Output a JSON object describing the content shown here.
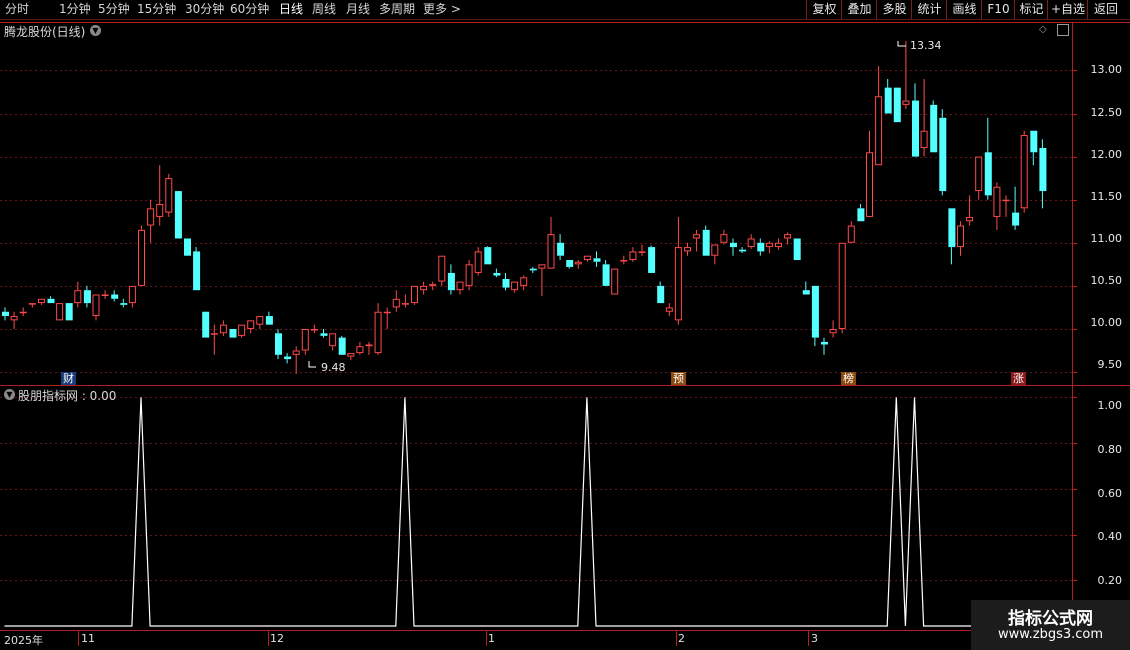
{
  "toolbar": {
    "periods": [
      "分时",
      "1分钟",
      "5分钟",
      "15分钟",
      "30分钟",
      "60分钟",
      "日线",
      "周线",
      "月线",
      "多周期",
      "更多 >"
    ],
    "active_period": "日线",
    "buttons": [
      "复权",
      "叠加",
      "多股",
      "统计",
      "画线",
      "F10",
      "标记",
      "+自选",
      "返回"
    ]
  },
  "main_pane": {
    "title": "腾龙股份(日线)",
    "y_ticks": [
      "13.00",
      "12.50",
      "12.00",
      "11.50",
      "11.00",
      "10.50",
      "10.00",
      "9.50"
    ],
    "high_label": "13.34",
    "low_label": "9.48",
    "tags": [
      "财",
      "预",
      "榜",
      "涨"
    ]
  },
  "indicator_pane": {
    "title": "股朋指标网 : 0.00",
    "y_ticks": [
      "1.00",
      "0.80",
      "0.60",
      "0.40",
      "0.20"
    ]
  },
  "x_axis": {
    "labels": [
      "2025年",
      "11",
      "12",
      "1",
      "2",
      "3"
    ]
  },
  "colors": {
    "up": "#ff4a4a",
    "down": "#54ffff",
    "frame": "#b41e1e",
    "signal": "#ffffff"
  },
  "chart_data": {
    "type": "candlestick",
    "ylim": [
      9.35,
      13.55
    ],
    "y_ticks": [
      13.0,
      12.5,
      12.0,
      11.5,
      11.0,
      10.5,
      10.0,
      9.5
    ],
    "high": 13.34,
    "low": 9.48,
    "ohlc": [
      [
        10.2,
        10.25,
        10.1,
        10.15
      ],
      [
        10.1,
        10.2,
        10.0,
        10.15
      ],
      [
        10.2,
        10.25,
        10.15,
        10.2
      ],
      [
        10.3,
        10.3,
        10.25,
        10.3
      ],
      [
        10.3,
        10.35,
        10.28,
        10.35
      ],
      [
        10.35,
        10.38,
        10.3,
        10.3
      ],
      [
        10.1,
        10.3,
        10.1,
        10.3
      ],
      [
        10.3,
        10.3,
        10.1,
        10.1
      ],
      [
        10.3,
        10.55,
        10.25,
        10.45
      ],
      [
        10.45,
        10.5,
        10.25,
        10.3
      ],
      [
        10.15,
        10.4,
        10.1,
        10.4
      ],
      [
        10.4,
        10.45,
        10.35,
        10.4
      ],
      [
        10.4,
        10.45,
        10.32,
        10.35
      ],
      [
        10.3,
        10.35,
        10.25,
        10.28
      ],
      [
        10.3,
        10.5,
        10.25,
        10.5
      ],
      [
        10.5,
        11.2,
        10.5,
        11.15
      ],
      [
        11.2,
        11.5,
        11.0,
        11.4
      ],
      [
        11.3,
        11.9,
        11.2,
        11.45
      ],
      [
        11.35,
        11.8,
        11.3,
        11.75
      ],
      [
        11.6,
        11.6,
        11.05,
        11.05
      ],
      [
        11.05,
        11.05,
        10.85,
        10.85
      ],
      [
        10.9,
        10.95,
        10.45,
        10.45
      ],
      [
        10.2,
        10.2,
        9.9,
        9.9
      ],
      [
        9.95,
        10.05,
        9.7,
        9.95
      ],
      [
        9.95,
        10.1,
        9.92,
        10.05
      ],
      [
        10.0,
        10.0,
        9.9,
        9.9
      ],
      [
        9.92,
        10.05,
        9.9,
        10.05
      ],
      [
        10.0,
        10.1,
        9.95,
        10.1
      ],
      [
        10.05,
        10.15,
        10.0,
        10.15
      ],
      [
        10.15,
        10.2,
        10.05,
        10.05
      ],
      [
        9.95,
        10.0,
        9.65,
        9.7
      ],
      [
        9.68,
        9.72,
        9.6,
        9.65
      ],
      [
        9.7,
        9.8,
        9.48,
        9.75
      ],
      [
        9.75,
        10.0,
        9.7,
        10.0
      ],
      [
        10.0,
        10.05,
        9.95,
        10.0
      ],
      [
        9.95,
        10.0,
        9.9,
        9.92
      ],
      [
        9.8,
        9.95,
        9.75,
        9.95
      ],
      [
        9.9,
        9.92,
        9.7,
        9.7
      ],
      [
        9.68,
        9.72,
        9.64,
        9.72
      ],
      [
        9.72,
        9.85,
        9.7,
        9.8
      ],
      [
        9.8,
        9.85,
        9.7,
        9.82
      ],
      [
        9.72,
        10.3,
        9.7,
        10.2
      ],
      [
        10.2,
        10.25,
        10.0,
        10.2
      ],
      [
        10.25,
        10.45,
        10.2,
        10.35
      ],
      [
        10.3,
        10.4,
        10.25,
        10.3
      ],
      [
        10.3,
        10.5,
        10.28,
        10.5
      ],
      [
        10.45,
        10.55,
        10.4,
        10.5
      ],
      [
        10.5,
        10.55,
        10.45,
        10.52
      ],
      [
        10.55,
        10.85,
        10.5,
        10.85
      ],
      [
        10.65,
        10.75,
        10.4,
        10.45
      ],
      [
        10.45,
        10.55,
        10.4,
        10.55
      ],
      [
        10.5,
        10.8,
        10.45,
        10.75
      ],
      [
        10.65,
        10.95,
        10.62,
        10.9
      ],
      [
        10.95,
        10.96,
        10.75,
        10.75
      ],
      [
        10.65,
        10.7,
        10.6,
        10.62
      ],
      [
        10.58,
        10.65,
        10.45,
        10.48
      ],
      [
        10.45,
        10.55,
        10.42,
        10.55
      ],
      [
        10.5,
        10.62,
        10.45,
        10.6
      ],
      [
        10.7,
        10.72,
        10.65,
        10.68
      ],
      [
        10.7,
        10.75,
        10.38,
        10.75
      ],
      [
        10.7,
        11.3,
        10.7,
        11.1
      ],
      [
        11.0,
        11.1,
        10.8,
        10.85
      ],
      [
        10.8,
        10.8,
        10.7,
        10.72
      ],
      [
        10.75,
        10.8,
        10.7,
        10.78
      ],
      [
        10.8,
        10.85,
        10.78,
        10.85
      ],
      [
        10.82,
        10.9,
        10.72,
        10.78
      ],
      [
        10.75,
        10.8,
        10.5,
        10.5
      ],
      [
        10.4,
        10.7,
        10.4,
        10.7
      ],
      [
        10.8,
        10.85,
        10.75,
        10.8
      ],
      [
        10.8,
        10.95,
        10.78,
        10.9
      ],
      [
        10.9,
        10.98,
        10.85,
        10.9
      ],
      [
        10.95,
        10.97,
        10.65,
        10.65
      ],
      [
        10.5,
        10.55,
        10.3,
        10.3
      ],
      [
        10.2,
        10.3,
        10.15,
        10.25
      ],
      [
        10.1,
        11.3,
        10.05,
        10.95
      ],
      [
        10.9,
        11.0,
        10.85,
        10.95
      ],
      [
        11.05,
        11.15,
        10.9,
        11.1
      ],
      [
        11.15,
        11.2,
        10.85,
        10.85
      ],
      [
        10.85,
        10.98,
        10.75,
        10.98
      ],
      [
        11.0,
        11.15,
        10.98,
        11.1
      ],
      [
        11.0,
        11.05,
        10.85,
        10.95
      ],
      [
        10.92,
        10.95,
        10.88,
        10.9
      ],
      [
        10.95,
        11.1,
        10.93,
        11.05
      ],
      [
        11.0,
        11.05,
        10.85,
        10.9
      ],
      [
        10.95,
        11.02,
        10.88,
        11.0
      ],
      [
        10.95,
        11.05,
        10.92,
        11.0
      ],
      [
        11.05,
        11.12,
        10.98,
        11.1
      ],
      [
        11.05,
        11.05,
        10.8,
        10.8
      ],
      [
        10.45,
        10.55,
        10.4,
        10.4
      ],
      [
        10.5,
        10.5,
        9.8,
        9.9
      ],
      [
        9.85,
        9.9,
        9.7,
        9.82
      ],
      [
        9.95,
        10.1,
        9.9,
        10.0
      ],
      [
        10.0,
        11.0,
        9.95,
        11.0
      ],
      [
        11.0,
        11.25,
        11.0,
        11.2
      ],
      [
        11.4,
        11.45,
        11.25,
        11.25
      ],
      [
        11.3,
        12.3,
        11.3,
        12.05
      ],
      [
        11.9,
        13.05,
        11.9,
        12.7
      ],
      [
        12.8,
        12.9,
        12.5,
        12.5
      ],
      [
        12.8,
        12.8,
        12.4,
        12.4
      ],
      [
        12.6,
        13.34,
        12.55,
        12.65
      ],
      [
        12.65,
        12.85,
        12.0,
        12.0
      ],
      [
        12.1,
        12.9,
        12.0,
        12.3
      ],
      [
        12.6,
        12.65,
        12.05,
        12.05
      ],
      [
        12.45,
        12.55,
        11.55,
        11.6
      ],
      [
        11.4,
        11.4,
        10.75,
        10.95
      ],
      [
        10.95,
        11.25,
        10.85,
        11.2
      ],
      [
        11.25,
        11.55,
        11.2,
        11.3
      ],
      [
        11.6,
        12.0,
        11.5,
        12.0
      ],
      [
        12.05,
        12.45,
        11.5,
        11.55
      ],
      [
        11.3,
        11.7,
        11.15,
        11.65
      ],
      [
        11.5,
        11.55,
        11.3,
        11.5
      ],
      [
        11.35,
        11.65,
        11.15,
        11.2
      ],
      [
        11.4,
        12.3,
        11.35,
        12.25
      ],
      [
        12.3,
        12.3,
        11.9,
        12.05
      ],
      [
        12.1,
        12.2,
        11.4,
        11.6
      ]
    ],
    "indicator": {
      "ylim": [
        0,
        1.05
      ],
      "y_ticks": [
        1.0,
        0.8,
        0.6,
        0.4,
        0.2
      ],
      "signal_bars": [
        15,
        44,
        64,
        98,
        100
      ]
    }
  }
}
